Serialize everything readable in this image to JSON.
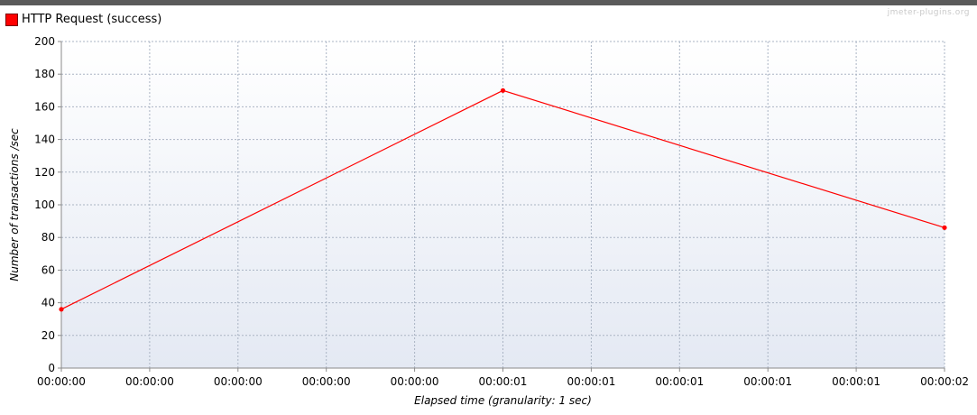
{
  "legend": {
    "label": "HTTP Request (success)",
    "color": "#ff0000"
  },
  "watermark": "jmeter-plugins.org",
  "colors": {
    "top_strip": "#5b5b5b",
    "plot_bg_top": "#ffffff",
    "plot_bg_bottom": "#e4e9f3",
    "grid": "#aab4c4",
    "axis": "#8a8a8a"
  },
  "chart_data": {
    "type": "line",
    "xlabel": "Elapsed time (granularity: 1 sec)",
    "ylabel": "Number of transactions /sec",
    "ylim": [
      0,
      200
    ],
    "yticks": [
      0,
      20,
      40,
      60,
      80,
      100,
      120,
      140,
      160,
      180,
      200
    ],
    "xlim": [
      0,
      2
    ],
    "xtick_labels": [
      "00:00:00",
      "00:00:00",
      "00:00:00",
      "00:00:00",
      "00:00:00",
      "00:00:01",
      "00:00:01",
      "00:00:01",
      "00:00:01",
      "00:00:01",
      "00:00:02"
    ],
    "grid": true,
    "legend_position": "top-left",
    "series": [
      {
        "name": "HTTP Request (success)",
        "color": "#ff0000",
        "x": [
          0,
          1,
          2
        ],
        "y": [
          36,
          170,
          86
        ]
      }
    ]
  }
}
